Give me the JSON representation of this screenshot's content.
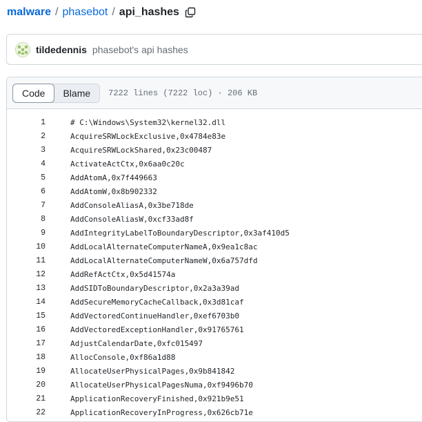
{
  "breadcrumb": {
    "repo_owner": "malware",
    "repo_name": "phasebot",
    "separator": "/",
    "file_name": "api_hashes"
  },
  "commit": {
    "author": "tildedennis",
    "message": "phasebot's api hashes"
  },
  "file_header": {
    "tabs": [
      "Code",
      "Blame"
    ],
    "active_tab": "Code",
    "info": "7222 lines (7222 loc) · 206 KB"
  },
  "lines": [
    {
      "n": "1",
      "text": "# C:\\Windows\\System32\\kernel32.dll"
    },
    {
      "n": "2",
      "text": "AcquireSRWLockExclusive,0x4784e83e"
    },
    {
      "n": "3",
      "text": "AcquireSRWLockShared,0x23c00487"
    },
    {
      "n": "4",
      "text": "ActivateActCtx,0x6aa0c20c"
    },
    {
      "n": "5",
      "text": "AddAtomA,0x7f449663"
    },
    {
      "n": "6",
      "text": "AddAtomW,0x8b902332"
    },
    {
      "n": "7",
      "text": "AddConsoleAliasA,0x3be718de"
    },
    {
      "n": "8",
      "text": "AddConsoleAliasW,0xcf33ad8f"
    },
    {
      "n": "9",
      "text": "AddIntegrityLabelToBoundaryDescriptor,0x3af410d5"
    },
    {
      "n": "10",
      "text": "AddLocalAlternateComputerNameA,0x9ea1c8ac"
    },
    {
      "n": "11",
      "text": "AddLocalAlternateComputerNameW,0x6a757dfd"
    },
    {
      "n": "12",
      "text": "AddRefActCtx,0x5d41574a"
    },
    {
      "n": "13",
      "text": "AddSIDToBoundaryDescriptor,0x2a3a39ad"
    },
    {
      "n": "14",
      "text": "AddSecureMemoryCacheCallback,0x3d81caf"
    },
    {
      "n": "15",
      "text": "AddVectoredContinueHandler,0xef6703b0"
    },
    {
      "n": "16",
      "text": "AddVectoredExceptionHandler,0x91765761"
    },
    {
      "n": "17",
      "text": "AdjustCalendarDate,0xfc015497"
    },
    {
      "n": "18",
      "text": "AllocConsole,0xf86a1d88"
    },
    {
      "n": "19",
      "text": "AllocateUserPhysicalPages,0x9b841842"
    },
    {
      "n": "20",
      "text": "AllocateUserPhysicalPagesNuma,0xf9496b70"
    },
    {
      "n": "21",
      "text": "ApplicationRecoveryFinished,0x921b9e51"
    },
    {
      "n": "22",
      "text": "ApplicationRecoveryInProgress,0x626cb71e"
    }
  ],
  "icons": {
    "copy": "copy-icon",
    "avatar": "identicon-avatar"
  },
  "colors": {
    "link": "#0969da",
    "border": "#d0d7de",
    "header_bg": "#f6f8fa",
    "muted": "#656d76"
  }
}
